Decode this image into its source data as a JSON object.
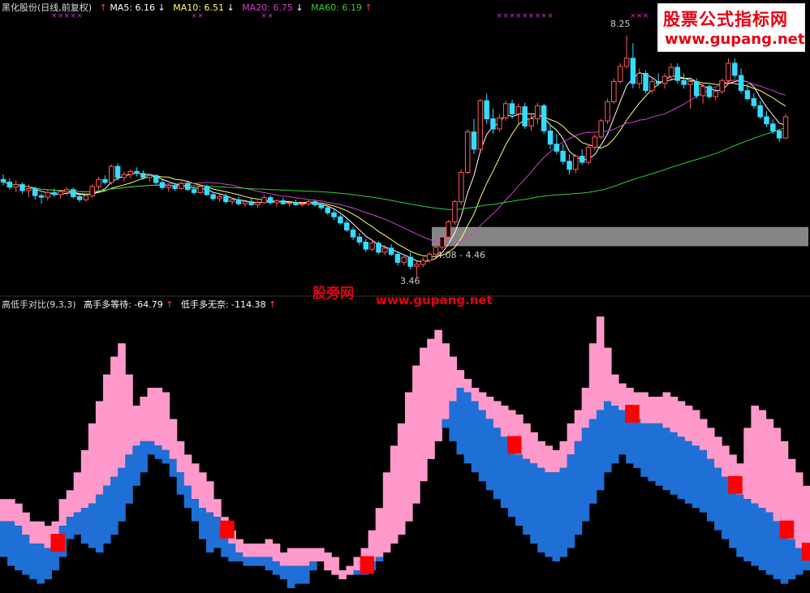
{
  "header": {
    "stock": "黑化股份(日线,前复权)",
    "ma5": "MA5: 6.16",
    "ma10": "MA10: 6.51",
    "ma20": "MA20: 6.75",
    "ma60": "MA60: 6.19",
    "ma5_color": "#ffffff",
    "ma10_color": "#ffff66",
    "ma20_color": "#d040d0",
    "ma60_color": "#33cc33"
  },
  "indicator_header": {
    "name": "高低手对比(9,3,3)",
    "high": "高手多等待: -64.79",
    "low": "低手多无奈: -114.38"
  },
  "watermark": {
    "line1": "股票公式指标网",
    "line2": "www.gupang.net",
    "mid_cn": "股旁网",
    "mid_url": "www.gupang.net"
  },
  "annotations": {
    "high_price": "8.25",
    "low_price": "3.46",
    "zone_label": "4.08 - 4.46"
  },
  "colors": {
    "up": "#ff5a5a",
    "down": "#33ddff",
    "pink": "#ff99cc",
    "blue": "#1e6fd6",
    "signal": "#ff0000",
    "zone": "#8c8c8c",
    "x_mark": "#cc33cc"
  },
  "chart_data": [
    {
      "type": "candlestick",
      "title": "黑化股份(日线,前复权)",
      "ylim": [
        3.3,
        8.6
      ],
      "ohlc": [
        [
          5.4,
          5.5,
          5.28,
          5.35
        ],
        [
          5.35,
          5.42,
          5.2,
          5.25
        ],
        [
          5.25,
          5.38,
          5.15,
          5.3
        ],
        [
          5.3,
          5.34,
          5.12,
          5.18
        ],
        [
          5.18,
          5.3,
          5.05,
          5.22
        ],
        [
          5.22,
          5.26,
          5.0,
          5.08
        ],
        [
          5.08,
          5.12,
          4.92,
          5.05
        ],
        [
          5.05,
          5.18,
          4.98,
          5.14
        ],
        [
          5.14,
          5.22,
          5.06,
          5.1
        ],
        [
          5.1,
          5.2,
          5.02,
          5.16
        ],
        [
          5.16,
          5.25,
          5.08,
          5.2
        ],
        [
          5.2,
          5.24,
          5.02,
          5.06
        ],
        [
          5.06,
          5.1,
          4.95,
          5.0
        ],
        [
          5.0,
          5.12,
          4.96,
          5.08
        ],
        [
          5.08,
          5.3,
          5.04,
          5.26
        ],
        [
          5.26,
          5.45,
          5.2,
          5.4
        ],
        [
          5.4,
          5.48,
          5.3,
          5.34
        ],
        [
          5.34,
          5.7,
          5.3,
          5.66
        ],
        [
          5.66,
          5.72,
          5.38,
          5.44
        ],
        [
          5.44,
          5.56,
          5.36,
          5.5
        ],
        [
          5.5,
          5.6,
          5.42,
          5.56
        ],
        [
          5.56,
          5.64,
          5.46,
          5.52
        ],
        [
          5.52,
          5.58,
          5.4,
          5.44
        ],
        [
          5.44,
          5.52,
          5.36,
          5.48
        ],
        [
          5.48,
          5.5,
          5.3,
          5.34
        ],
        [
          5.34,
          5.4,
          5.2,
          5.24
        ],
        [
          5.24,
          5.32,
          5.16,
          5.28
        ],
        [
          5.28,
          5.34,
          5.18,
          5.22
        ],
        [
          5.22,
          5.36,
          5.2,
          5.32
        ],
        [
          5.32,
          5.38,
          5.18,
          5.2
        ],
        [
          5.2,
          5.26,
          5.1,
          5.14
        ],
        [
          5.14,
          5.3,
          5.12,
          5.26
        ],
        [
          5.26,
          5.3,
          5.08,
          5.1
        ],
        [
          5.1,
          5.16,
          4.98,
          5.02
        ],
        [
          5.02,
          5.1,
          4.96,
          5.06
        ],
        [
          5.06,
          5.12,
          4.92,
          4.96
        ],
        [
          4.96,
          5.04,
          4.9,
          5.0
        ],
        [
          5.0,
          5.06,
          4.88,
          4.92
        ],
        [
          4.92,
          5.0,
          4.86,
          4.96
        ],
        [
          4.96,
          5.02,
          4.88,
          4.9
        ],
        [
          4.9,
          4.98,
          4.84,
          4.94
        ],
        [
          4.94,
          5.1,
          4.92,
          5.04
        ],
        [
          5.04,
          5.08,
          4.9,
          4.94
        ],
        [
          4.94,
          5.0,
          4.86,
          4.98
        ],
        [
          4.98,
          5.04,
          4.9,
          4.92
        ],
        [
          4.92,
          4.96,
          4.86,
          4.94
        ],
        [
          4.94,
          5.0,
          4.88,
          4.9
        ],
        [
          4.9,
          4.96,
          4.86,
          4.92
        ],
        [
          4.92,
          5.0,
          4.88,
          4.96
        ],
        [
          4.96,
          5.0,
          4.86,
          4.9
        ],
        [
          4.9,
          4.94,
          4.8,
          4.84
        ],
        [
          4.84,
          4.88,
          4.7,
          4.74
        ],
        [
          4.74,
          4.8,
          4.6,
          4.66
        ],
        [
          4.66,
          4.7,
          4.5,
          4.54
        ],
        [
          4.54,
          4.6,
          4.36,
          4.4
        ],
        [
          4.4,
          4.46,
          4.2,
          4.26
        ],
        [
          4.26,
          4.34,
          4.1,
          4.16
        ],
        [
          4.16,
          4.22,
          3.96,
          4.02
        ],
        [
          4.02,
          4.2,
          3.98,
          4.14
        ],
        [
          4.14,
          4.18,
          3.92,
          3.96
        ],
        [
          3.96,
          4.1,
          3.9,
          4.04
        ],
        [
          4.04,
          4.12,
          3.88,
          3.92
        ],
        [
          3.92,
          3.98,
          3.7,
          3.76
        ],
        [
          3.76,
          3.92,
          3.7,
          3.86
        ],
        [
          3.86,
          3.96,
          3.62,
          3.68
        ],
        [
          3.68,
          3.78,
          3.46,
          3.72
        ],
        [
          3.72,
          3.86,
          3.66,
          3.8
        ],
        [
          3.8,
          3.96,
          3.76,
          3.92
        ],
        [
          3.92,
          4.1,
          3.88,
          4.06
        ],
        [
          4.06,
          4.3,
          4.0,
          4.26
        ],
        [
          4.26,
          4.6,
          4.2,
          4.56
        ],
        [
          4.56,
          5.0,
          4.5,
          4.96
        ],
        [
          4.96,
          5.6,
          4.9,
          5.54
        ],
        [
          5.54,
          6.4,
          5.5,
          6.34
        ],
        [
          6.34,
          6.6,
          5.9,
          6.0
        ],
        [
          6.0,
          7.0,
          5.96,
          6.96
        ],
        [
          6.96,
          7.1,
          6.5,
          6.6
        ],
        [
          6.6,
          6.8,
          6.3,
          6.4
        ],
        [
          6.4,
          6.7,
          6.34,
          6.62
        ],
        [
          6.62,
          6.96,
          6.56,
          6.9
        ],
        [
          6.9,
          6.98,
          6.6,
          6.7
        ],
        [
          6.7,
          6.9,
          6.5,
          6.84
        ],
        [
          6.84,
          6.92,
          6.4,
          6.46
        ],
        [
          6.46,
          6.7,
          6.36,
          6.6
        ],
        [
          6.6,
          6.92,
          6.5,
          6.86
        ],
        [
          6.86,
          6.9,
          6.3,
          6.36
        ],
        [
          6.36,
          6.5,
          6.0,
          6.1
        ],
        [
          6.1,
          6.3,
          5.9,
          5.96
        ],
        [
          5.96,
          6.1,
          5.7,
          5.76
        ],
        [
          5.76,
          5.9,
          5.5,
          5.6
        ],
        [
          5.6,
          5.9,
          5.52,
          5.86
        ],
        [
          5.86,
          6.0,
          5.7,
          5.74
        ],
        [
          5.74,
          6.1,
          5.7,
          6.04
        ],
        [
          6.04,
          6.3,
          5.98,
          6.24
        ],
        [
          6.24,
          6.6,
          6.2,
          6.56
        ],
        [
          6.56,
          7.0,
          6.5,
          6.94
        ],
        [
          6.94,
          7.4,
          6.9,
          7.34
        ],
        [
          7.34,
          7.7,
          7.3,
          7.64
        ],
        [
          7.64,
          8.25,
          7.6,
          7.8
        ],
        [
          7.8,
          8.1,
          7.2,
          7.3
        ],
        [
          7.3,
          7.6,
          7.2,
          7.5
        ],
        [
          7.5,
          7.56,
          7.1,
          7.16
        ],
        [
          7.16,
          7.4,
          7.1,
          7.34
        ],
        [
          7.34,
          7.5,
          7.26,
          7.3
        ],
        [
          7.3,
          7.5,
          7.2,
          7.44
        ],
        [
          7.44,
          7.7,
          7.38,
          7.62
        ],
        [
          7.62,
          7.7,
          7.3,
          7.36
        ],
        [
          7.36,
          7.5,
          7.2,
          7.28
        ],
        [
          7.28,
          7.4,
          6.8,
          7.34
        ],
        [
          7.34,
          7.4,
          7.0,
          7.06
        ],
        [
          7.06,
          7.3,
          6.9,
          7.24
        ],
        [
          7.24,
          7.28,
          7.0,
          7.04
        ],
        [
          7.04,
          7.2,
          6.96,
          7.14
        ],
        [
          7.14,
          7.4,
          7.1,
          7.36
        ],
        [
          7.36,
          7.8,
          7.3,
          7.7
        ],
        [
          7.7,
          7.8,
          7.4,
          7.46
        ],
        [
          7.46,
          7.6,
          7.1,
          7.16
        ],
        [
          7.16,
          7.3,
          6.96,
          7.0
        ],
        [
          7.0,
          7.1,
          6.8,
          6.86
        ],
        [
          6.86,
          6.96,
          6.6,
          6.64
        ],
        [
          6.64,
          6.76,
          6.44,
          6.5
        ],
        [
          6.5,
          6.6,
          6.3,
          6.36
        ],
        [
          6.36,
          6.4,
          6.14,
          6.22
        ],
        [
          6.22,
          6.7,
          6.2,
          6.64
        ]
      ],
      "ma_labels": [
        "MA5",
        "MA10",
        "MA20",
        "MA60"
      ],
      "high_label": "8.25",
      "low_label": "3.46",
      "zone": [
        4.08,
        4.46
      ]
    },
    {
      "type": "bar",
      "title": "高低手对比(9,3,3)",
      "series": [
        {
          "name": "高手多等待",
          "values": [
            -64.79
          ]
        },
        {
          "name": "低手多无奈",
          "values": [
            -114.38
          ]
        }
      ],
      "pink_top": [
        40,
        40,
        38,
        34,
        30,
        30,
        28,
        30,
        40,
        44,
        52,
        62,
        74,
        84,
        96,
        104,
        110,
        96,
        82,
        86,
        90,
        90,
        88,
        76,
        66,
        60,
        56,
        52,
        48,
        40,
        32,
        26,
        22,
        20,
        20,
        20,
        22,
        20,
        16,
        18,
        18,
        18,
        18,
        18,
        16,
        14,
        8,
        10,
        14,
        18,
        26,
        36,
        52,
        64,
        74,
        88,
        100,
        108,
        112,
        116,
        110,
        104,
        98,
        94,
        90,
        88,
        86,
        84,
        82,
        80,
        78,
        74,
        70,
        66,
        64,
        62,
        66,
        74,
        80,
        90,
        110,
        122,
        108,
        96,
        92,
        90,
        88,
        88,
        86,
        86,
        88,
        86,
        84,
        82,
        80,
        76,
        72,
        68,
        64,
        60,
        56,
        72,
        82,
        80,
        76,
        72,
        66,
        58,
        52,
        46
      ],
      "pink_bottom": [
        30,
        30,
        28,
        24,
        20,
        20,
        18,
        20,
        28,
        32,
        34,
        36,
        38,
        42,
        46,
        50,
        54,
        60,
        64,
        66,
        66,
        64,
        62,
        58,
        52,
        46,
        40,
        36,
        34,
        32,
        26,
        20,
        16,
        14,
        14,
        14,
        14,
        12,
        10,
        10,
        10,
        10,
        12,
        12,
        8,
        6,
        4,
        6,
        8,
        10,
        12,
        14,
        16,
        20,
        24,
        30,
        38,
        48,
        58,
        66,
        76,
        84,
        90,
        88,
        84,
        80,
        76,
        72,
        68,
        64,
        60,
        58,
        56,
        54,
        52,
        52,
        54,
        60,
        66,
        72,
        76,
        80,
        84,
        82,
        80,
        78,
        76,
        74,
        74,
        74,
        72,
        70,
        68,
        66,
        64,
        62,
        58,
        54,
        50,
        46,
        42,
        40,
        38,
        36,
        34,
        30,
        26,
        22,
        18,
        16
      ],
      "blue_bottom": [
        14,
        10,
        8,
        6,
        4,
        2,
        4,
        8,
        14,
        22,
        24,
        20,
        18,
        16,
        20,
        24,
        30,
        38,
        46,
        52,
        60,
        58,
        56,
        50,
        42,
        36,
        30,
        22,
        16,
        18,
        14,
        12,
        12,
        10,
        10,
        10,
        8,
        6,
        4,
        0,
        2,
        2,
        8,
        12,
        14,
        10,
        8,
        8,
        6,
        6,
        8,
        12,
        18,
        24,
        34,
        46,
        58,
        68,
        74,
        76,
        72,
        66,
        60,
        56,
        52,
        48,
        44,
        40,
        36,
        32,
        28,
        24,
        20,
        16,
        14,
        12,
        14,
        18,
        24,
        30,
        38,
        44,
        52,
        56,
        60,
        56,
        54,
        50,
        48,
        46,
        44,
        42,
        40,
        38,
        36,
        34,
        30,
        26,
        22,
        18,
        14,
        12,
        10,
        8,
        6,
        4,
        2,
        4,
        6,
        8
      ],
      "red_signals": [
        8,
        34,
        55,
        78,
        96,
        112,
        120,
        131
      ]
    }
  ]
}
